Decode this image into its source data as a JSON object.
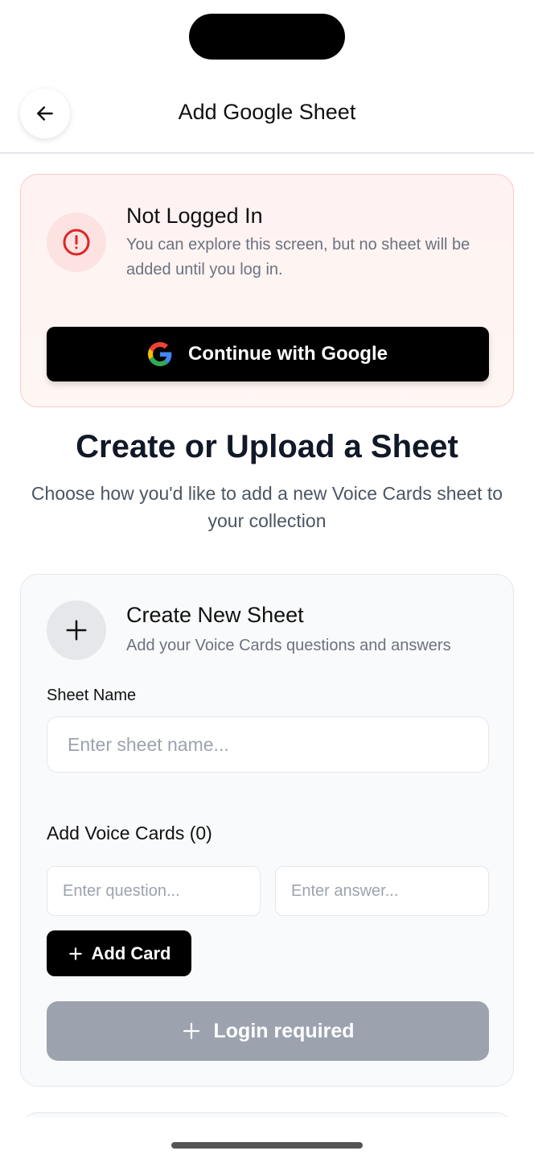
{
  "header": {
    "title": "Add Google Sheet",
    "back_icon": "arrow-left-icon"
  },
  "alert": {
    "title": "Not Logged In",
    "message": "You can explore this screen, but no sheet will be added until you log in.",
    "icon": "alert-circle-icon",
    "google_button_label": "Continue with Google"
  },
  "intro": {
    "title": "Create or Upload a Sheet",
    "subtitle": "Choose how you'd like to add a new Voice Cards sheet to your collection"
  },
  "create_card": {
    "title": "Create New Sheet",
    "subtitle": "Add your Voice Cards questions and answers",
    "sheet_name_label": "Sheet Name",
    "sheet_name_placeholder": "Enter sheet name...",
    "sheet_name_value": "",
    "voice_cards_label": "Add Voice Cards (0)",
    "question_placeholder": "Enter question...",
    "answer_placeholder": "Enter answer...",
    "add_card_label": "Add Card",
    "login_button_label": "Login required"
  },
  "colors": {
    "alert_bg": "#fef2f2",
    "alert_border": "#fbcaca",
    "alert_icon": "#dc2626",
    "primary_button": "#000000",
    "disabled_button": "#9ca3af"
  }
}
